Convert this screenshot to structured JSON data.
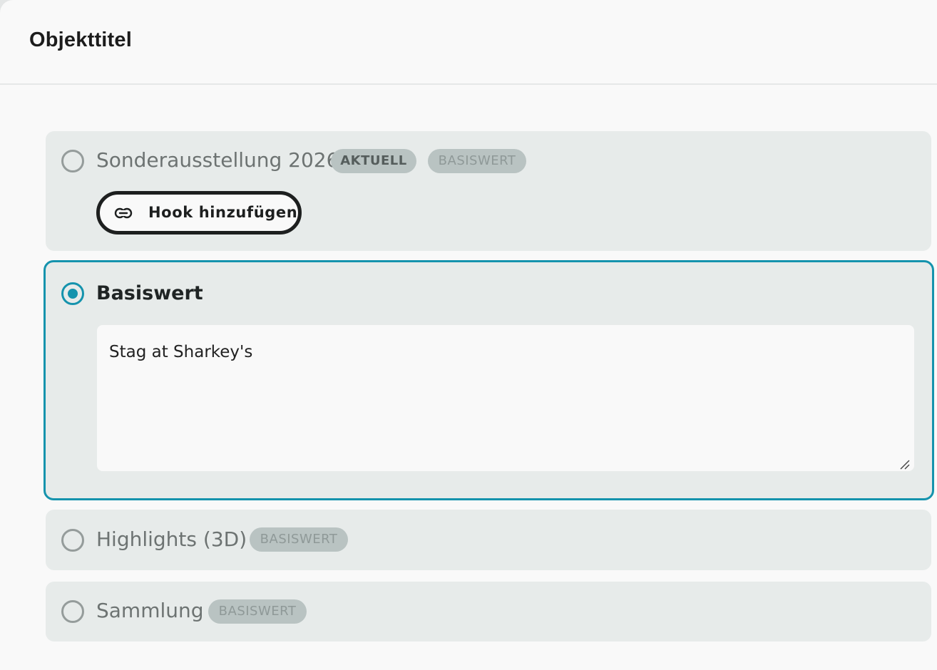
{
  "dialog": {
    "title": "Objekttitel"
  },
  "options": [
    {
      "label": "Sonderausstellung 2026",
      "badges": [
        "AKTUELL",
        "BASISWERT"
      ],
      "hook_button": "Hook hinzufügen",
      "selected": false
    },
    {
      "label": "Basiswert",
      "value": "Stag at Sharkey's",
      "selected": true
    },
    {
      "label": "Highlights (3D)",
      "badges": [
        "BASISWERT"
      ],
      "selected": false
    },
    {
      "label": "Sammlung",
      "badges": [
        "BASISWERT"
      ],
      "selected": false
    }
  ],
  "colors": {
    "accent": "#1593ad",
    "card_background": "#e7ebea",
    "badge_background": "#b9c3c2"
  },
  "icons": {
    "hook": "link-icon",
    "resize": "resize-handle-icon"
  }
}
